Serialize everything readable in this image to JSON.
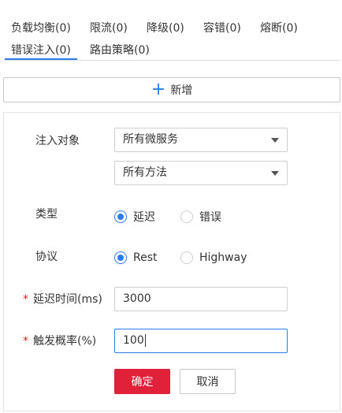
{
  "tabs": [
    {
      "label": "负载均衡(0)"
    },
    {
      "label": "限流(0)"
    },
    {
      "label": "降级(0)"
    },
    {
      "label": "容错(0)"
    },
    {
      "label": "熔断(0)"
    },
    {
      "label": "错误注入(0)"
    },
    {
      "label": "路由策略(0)"
    }
  ],
  "active_tab": "错误注入(0)",
  "add_button": {
    "label": "新增"
  },
  "form": {
    "target": {
      "label": "注入对象",
      "service_select": "所有微服务",
      "method_select": "所有方法"
    },
    "type": {
      "label": "类型",
      "options": [
        {
          "label": "延迟",
          "selected": true
        },
        {
          "label": "错误",
          "selected": false
        }
      ]
    },
    "protocol": {
      "label": "协议",
      "options": [
        {
          "label": "Rest",
          "selected": true
        },
        {
          "label": "Highway",
          "selected": false
        }
      ]
    },
    "delay": {
      "required_mark": "*",
      "label": "延迟时间(ms)",
      "value": "3000"
    },
    "probability": {
      "required_mark": "*",
      "label": "触发概率(%)",
      "value": "100"
    },
    "confirm_label": "确定",
    "cancel_label": "取消"
  },
  "colors": {
    "accent": "#2b7de9",
    "primary_button": "#e1213a",
    "required": "#e02020"
  }
}
